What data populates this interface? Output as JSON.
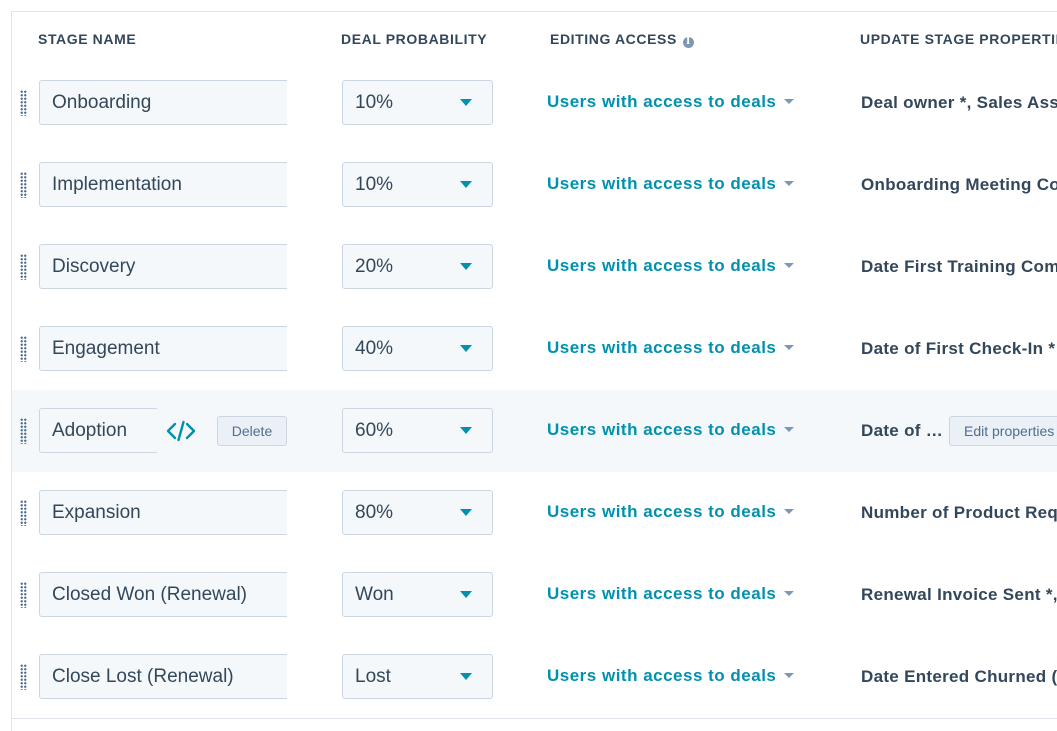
{
  "header": {
    "stage_name": "STAGE NAME",
    "deal_probability": "DEAL PROBABILITY",
    "editing_access": "EDITING ACCESS",
    "update_stage_properties": "UPDATE STAGE PROPERTIES"
  },
  "rows": [
    {
      "name": "Onboarding",
      "probability": "10%",
      "access": "Users with access to deals",
      "properties": "Deal owner *, Sales Assis"
    },
    {
      "name": "Implementation",
      "probability": "10%",
      "access": "Users with access to deals",
      "properties": "Onboarding Meeting Co…"
    },
    {
      "name": "Discovery",
      "probability": "20%",
      "access": "Users with access to deals",
      "properties": "Date First Training Comp"
    },
    {
      "name": "Engagement",
      "probability": "40%",
      "access": "Users with access to deals",
      "properties": "Date of First Check-In * …"
    },
    {
      "name": "Adoption",
      "probability": "60%",
      "access": "Users with access to deals",
      "properties": "Date of …",
      "delete_label": "Delete",
      "edit_properties_label": "Edit properties"
    },
    {
      "name": "Expansion",
      "probability": "80%",
      "access": "Users with access to deals",
      "properties": "Number of Product Requ"
    },
    {
      "name": "Closed Won (Renewal)",
      "probability": "Won",
      "access": "Users with access to deals",
      "properties": "Renewal Invoice Sent *, …"
    },
    {
      "name": "Close Lost (Renewal)",
      "probability": "Lost",
      "access": "Users with access to deals",
      "properties": "Date Entered Churned (C"
    }
  ],
  "colors": {
    "link": "#0091ae",
    "text": "#33475b",
    "border": "#dfe3eb",
    "input_bg": "#f5f8fa"
  }
}
